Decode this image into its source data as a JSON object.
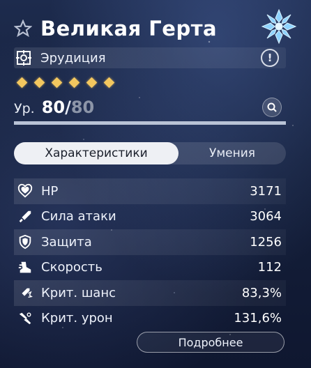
{
  "character": {
    "name": "Великая Герта",
    "path": "Эрудиция",
    "rarity": 6,
    "level_label": "Ур.",
    "level_current": "80",
    "level_separator": "/",
    "level_max": "80",
    "level_progress": 1.0,
    "element_icon": "ice-element-icon",
    "path_icon": "erudition-path-icon",
    "favorite_icon": "star-icon",
    "accent_color": "#f3c75f"
  },
  "tabs": [
    {
      "label": "Характеристики",
      "active": true
    },
    {
      "label": "Умения",
      "active": false
    }
  ],
  "stats": [
    {
      "label": "HP",
      "value": "3171",
      "icon": "heart-icon"
    },
    {
      "label": "Сила атаки",
      "value": "3064",
      "icon": "sword-icon"
    },
    {
      "label": "Защита",
      "value": "1256",
      "icon": "shield-icon"
    },
    {
      "label": "Скорость",
      "value": "112",
      "icon": "boot-icon"
    },
    {
      "label": "Крит. шанс",
      "value": "83,3%",
      "icon": "crit-rate-icon"
    },
    {
      "label": "Крит. урон",
      "value": "131,6%",
      "icon": "crit-damage-icon"
    }
  ],
  "details_button": "Подробнее"
}
